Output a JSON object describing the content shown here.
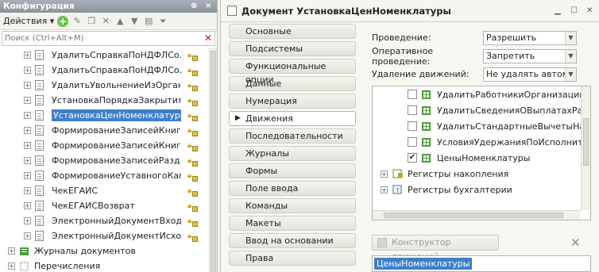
{
  "config_panel": {
    "title": "Конфигурация",
    "pin": "ф",
    "close": "×",
    "actions_label": "Действия",
    "search_placeholder": "Поиск (Ctrl+Alt+M)",
    "tree": [
      {
        "label": "УдалитьСправкаПоНДФЛСо..."
      },
      {
        "label": "УдалитьСправкаПоНДФЛСо..."
      },
      {
        "label": "УдалитьУвольнениеИзОрган..."
      },
      {
        "label": "УстановкаПорядкаЗакрытия..."
      },
      {
        "label": "УстановкаЦенНоменклатуры"
      },
      {
        "label": "ФормированиеЗаписейКниги..."
      },
      {
        "label": "ФормированиеЗаписейКниги..."
      },
      {
        "label": "ФормированиеЗаписейРазд..."
      },
      {
        "label": "ФормированиеУставногоКап..."
      },
      {
        "label": "ЧекЕГАИС"
      },
      {
        "label": "ЧекЕГАИСВозврат"
      },
      {
        "label": "ЭлектронныйДокументВходя..."
      },
      {
        "label": "ЭлектронныйДокументИсход..."
      }
    ],
    "groups": [
      {
        "label": "Журналы документов"
      },
      {
        "label": "Перечисления"
      }
    ]
  },
  "document": {
    "title": "Документ УстановкаЦенНоменклатуры",
    "tabs": [
      {
        "label": "Основные"
      },
      {
        "label": "Подсистемы"
      },
      {
        "label": "Функциональные опции"
      },
      {
        "label": "Данные"
      },
      {
        "label": "Нумерация"
      },
      {
        "label": "Движения"
      },
      {
        "label": "Последовательности"
      },
      {
        "label": "Журналы"
      },
      {
        "label": "Формы"
      },
      {
        "label": "Поле ввода"
      },
      {
        "label": "Команды"
      },
      {
        "label": "Макеты"
      },
      {
        "label": "Ввод на основании"
      },
      {
        "label": "Права"
      }
    ],
    "fields": [
      {
        "label": "Проведение:",
        "value": "Разрешить"
      },
      {
        "label": "Оперативное проведение:",
        "value": "Запретить"
      },
      {
        "label": "Удаление движений:",
        "value": "Не удалять автоматич"
      }
    ],
    "registers": [
      {
        "label": "УдалитьРаботникиОрганизаций",
        "checked": false
      },
      {
        "label": "УдалитьСведенияОВыплатахРабо",
        "checked": false
      },
      {
        "label": "УдалитьСтандартныеВычетыНаДо",
        "checked": false
      },
      {
        "label": "УсловияУдержанияПоИсполнител",
        "checked": false
      },
      {
        "label": "ЦеныНоменклатуры",
        "checked": true
      }
    ],
    "register_groups": [
      {
        "label": "Регистры накопления"
      },
      {
        "label": "Регистры бухгалтерии"
      }
    ],
    "constructor_label": "Конструктор движений",
    "selected_register": "ЦеныНоменклатуры"
  }
}
